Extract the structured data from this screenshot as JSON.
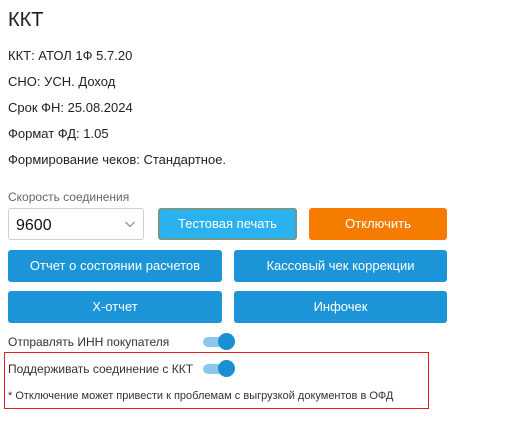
{
  "title": "ККТ",
  "info": {
    "kkt": "ККТ: АТОЛ 1Ф 5.7.20",
    "sno": "СНО: УСН. Доход",
    "fn_term": "Срок ФН: 25.08.2024",
    "fd_format": "Формат ФД: 1.05",
    "receipts": "Формирование чеков: Стандартное."
  },
  "speed": {
    "label": "Скорость соединения",
    "value": "9600"
  },
  "buttons": {
    "test_print": "Тестовая печать",
    "disconnect": "Отключить",
    "report": "Отчет о состоянии расчетов",
    "correction": "Кассовый чек коррекции",
    "x_report": "Х-отчет",
    "info_receipt": "Инфочек"
  },
  "toggles": {
    "send_inn": {
      "label": "Отправлять ИНН покупателя",
      "on": true
    },
    "support_connection": {
      "label": "Поддерживать соединение с ККТ",
      "on": true
    }
  },
  "note": "* Отключение может привести к проблемам с выгрузкой документов в ОФД",
  "colors": {
    "primary": "#1b95d8",
    "test_button": "#2ab1ef",
    "disconnect_button": "#f57c00",
    "highlight_border": "#e02020",
    "toggle_on": "#1b8fd4"
  }
}
